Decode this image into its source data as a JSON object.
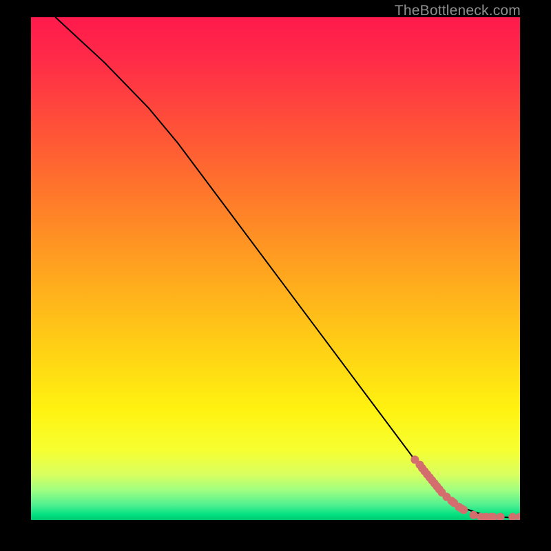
{
  "watermark": "TheBottleneck.com",
  "chart_data": {
    "type": "line",
    "title": "",
    "xlabel": "",
    "ylabel": "",
    "xlim": [
      0,
      100
    ],
    "ylim": [
      0,
      100
    ],
    "grid": false,
    "legend": false,
    "background_gradient": {
      "orientation": "vertical",
      "stops": [
        {
          "pos": 0.0,
          "color": "#ff1a4c"
        },
        {
          "pos": 0.5,
          "color": "#ffa31f"
        },
        {
          "pos": 0.78,
          "color": "#fff210"
        },
        {
          "pos": 0.97,
          "color": "#50f090"
        },
        {
          "pos": 1.0,
          "color": "#00c870"
        }
      ]
    },
    "series": [
      {
        "name": "curve",
        "style": "line",
        "color": "#000000",
        "x": [
          5,
          15,
          24,
          30,
          40,
          50,
          60,
          70,
          80,
          84,
          88,
          92,
          96,
          100
        ],
        "y": [
          100,
          91,
          82,
          75,
          62,
          49,
          36,
          23,
          10,
          5,
          2.5,
          1.2,
          0.6,
          0.4
        ]
      },
      {
        "name": "points",
        "style": "scatter",
        "color": "#d46d6d",
        "marker_radius_px": 6,
        "x": [
          78.5,
          79.5,
          80.0,
          80.5,
          81.0,
          81.5,
          82.0,
          82.5,
          83.0,
          83.5,
          84.0,
          85.0,
          86.0,
          86.5,
          87.5,
          88.0,
          88.5,
          90.5,
          92.0,
          93.0,
          94.0,
          94.5,
          96.0,
          98.5,
          100.0
        ],
        "y": [
          12.0,
          11.0,
          10.3,
          9.7,
          9.1,
          8.5,
          7.9,
          7.3,
          6.7,
          6.1,
          5.5,
          4.6,
          3.8,
          3.4,
          2.6,
          2.3,
          2.0,
          1.0,
          0.6,
          0.6,
          0.6,
          0.6,
          0.6,
          0.6,
          0.6
        ]
      }
    ]
  }
}
